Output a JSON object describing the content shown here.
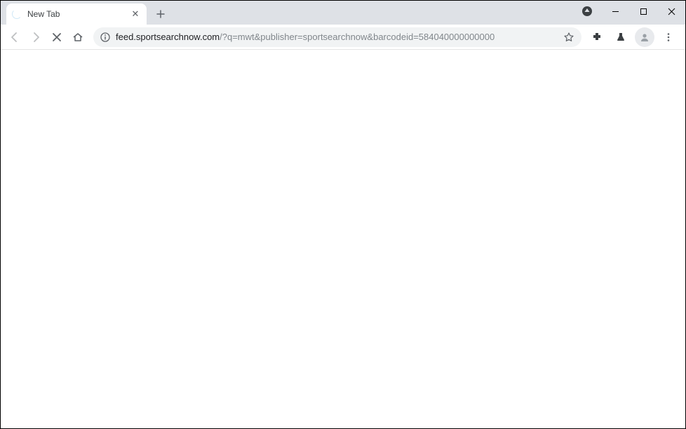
{
  "tab": {
    "title": "New Tab"
  },
  "url": {
    "host": "feed.sportsearchnow.com",
    "path": "/?q=mwt&publisher=sportsearchnow&barcodeid=584040000000000"
  },
  "icons": {
    "close_glyph": "✕",
    "plus_glyph": "+"
  }
}
